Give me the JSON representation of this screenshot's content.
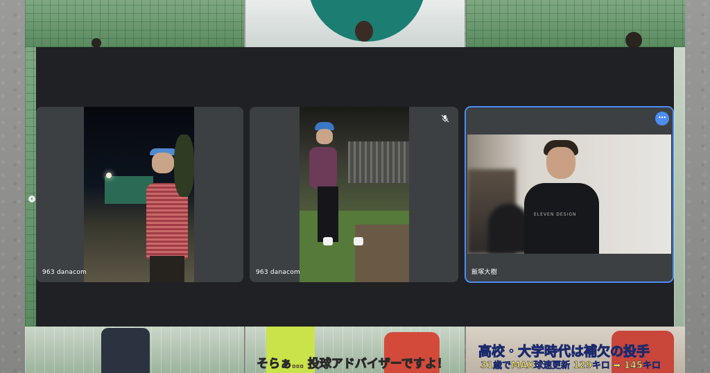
{
  "meeting": {
    "participants": [
      {
        "name": "963 danacom",
        "muted": false
      },
      {
        "name": "963 danacom",
        "muted": true
      },
      {
        "name": "飯塚大樹",
        "muted": false,
        "active": true
      }
    ],
    "more_options_icon": "more-options-icon",
    "accent_color": "#4c8df6"
  },
  "captions": {
    "bottom_center": "そらぁ… 投球アドバイザーですよ！",
    "bottom_right_title": "高校・大学時代は補欠の投手",
    "bottom_right_sub": "31歳でMAX球速更新 129キロ ➡ 145キロ"
  },
  "shirt_text": "ELEVEN DESIGN"
}
